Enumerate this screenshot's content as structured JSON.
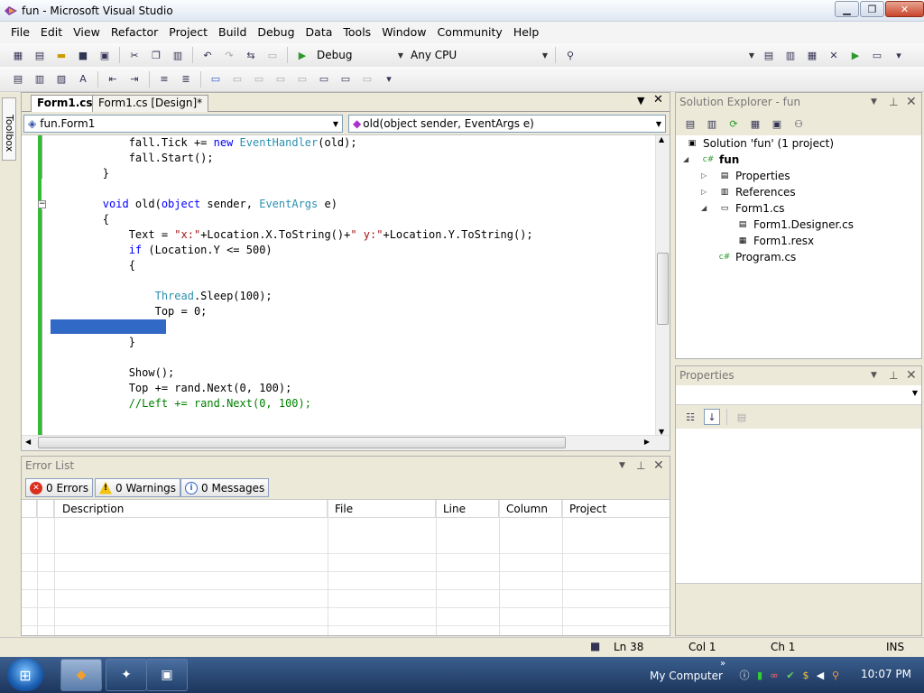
{
  "window": {
    "title": "fun - Microsoft Visual Studio"
  },
  "menu": [
    "File",
    "Edit",
    "View",
    "Refactor",
    "Project",
    "Build",
    "Debug",
    "Data",
    "Tools",
    "Window",
    "Community",
    "Help"
  ],
  "toolbar": {
    "config": "Debug",
    "platform": "Any CPU"
  },
  "toolbox": {
    "label": "Toolbox"
  },
  "editor": {
    "tabs": [
      "Form1.cs*",
      "Form1.cs [Design]*"
    ],
    "class_combo": "fun.Form1",
    "member_combo": "old(object sender, EventArgs e)",
    "lines": [
      [
        {
          "t": "            fall.Tick += "
        },
        {
          "t": "new",
          "c": "kw"
        },
        {
          "t": " "
        },
        {
          "t": "EventHandler",
          "c": "ty"
        },
        {
          "t": "(old);"
        }
      ],
      [
        {
          "t": "            fall.Start();"
        }
      ],
      [
        {
          "t": "        }"
        }
      ],
      [
        {
          "t": ""
        }
      ],
      [
        {
          "t": "        "
        },
        {
          "t": "void",
          "c": "kw"
        },
        {
          "t": " old("
        },
        {
          "t": "object",
          "c": "kw"
        },
        {
          "t": " sender, "
        },
        {
          "t": "EventArgs",
          "c": "ty"
        },
        {
          "t": " e)"
        }
      ],
      [
        {
          "t": "        {"
        }
      ],
      [
        {
          "t": "            Text = "
        },
        {
          "t": "\"x:\"",
          "c": "st"
        },
        {
          "t": "+Location.X.ToString()+"
        },
        {
          "t": "\" y:\"",
          "c": "st"
        },
        {
          "t": "+Location.Y.ToString();"
        }
      ],
      [
        {
          "t": "            "
        },
        {
          "t": "if",
          "c": "kw"
        },
        {
          "t": " (Location.Y <= 500)"
        }
      ],
      [
        {
          "t": "            {"
        }
      ],
      [
        {
          "t": ""
        }
      ],
      [
        {
          "t": "                "
        },
        {
          "t": "Thread",
          "c": "ty"
        },
        {
          "t": ".Sleep(100);"
        }
      ],
      [
        {
          "t": "                Top = 0;"
        }
      ],
      [
        {
          "t": ""
        }
      ],
      [
        {
          "t": "            }"
        }
      ],
      [
        {
          "t": ""
        }
      ],
      [
        {
          "t": "            Show();"
        }
      ],
      [
        {
          "t": "            Top += rand.Next(0, 100);"
        }
      ],
      [
        {
          "t": "            //Left += rand.Next(0, 100);",
          "c": "cm"
        }
      ]
    ]
  },
  "error_list": {
    "title": "Error List",
    "buttons": {
      "errors": "0 Errors",
      "warnings": "0 Warnings",
      "messages": "0 Messages"
    },
    "columns": [
      "Description",
      "File",
      "Line",
      "Column",
      "Project"
    ]
  },
  "solution_explorer": {
    "title": "Solution Explorer - fun",
    "items": {
      "solution": "Solution 'fun' (1 project)",
      "project": "fun",
      "properties": "Properties",
      "references": "References",
      "form1": "Form1.cs",
      "form1_designer": "Form1.Designer.cs",
      "form1_resx": "Form1.resx",
      "program": "Program.cs"
    }
  },
  "properties": {
    "title": "Properties"
  },
  "status": {
    "ln": "Ln 38",
    "col": "Col 1",
    "ch": "Ch 1",
    "mode": "INS"
  },
  "taskbar": {
    "my_computer": "My Computer",
    "time": "10:07 PM"
  },
  "colors": {
    "keyword": "#0000ff",
    "type": "#2b91af",
    "string": "#a31515",
    "comment": "#008000",
    "selection": "#3169c6"
  }
}
